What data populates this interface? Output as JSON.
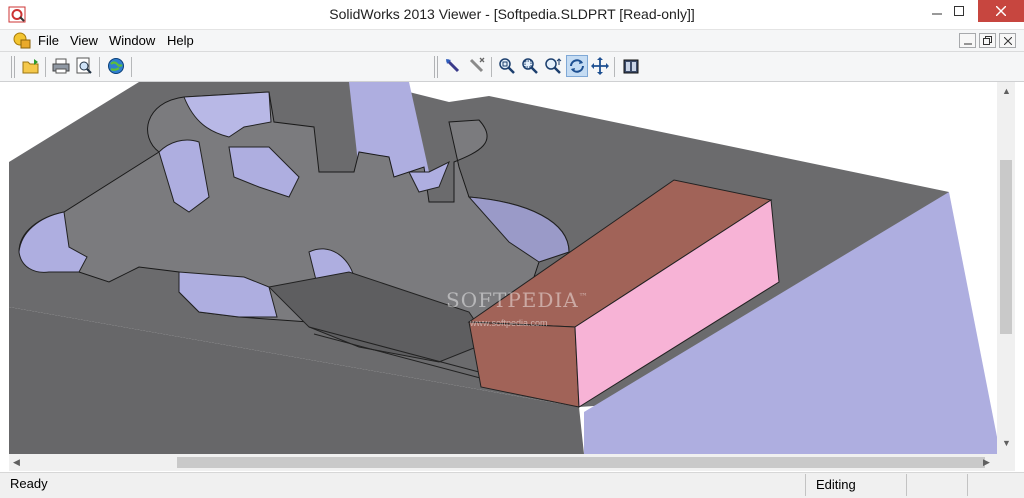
{
  "window": {
    "title": "SolidWorks 2013 Viewer - [Softpedia.SLDPRT [Read-only]]",
    "accent_close": "#c7463f"
  },
  "menu": {
    "items": [
      "File",
      "View",
      "Window",
      "Help"
    ]
  },
  "toolbar": {
    "buttons": [
      "open-icon",
      "print-icon",
      "print-preview-icon",
      "web-icon",
      "select-icon",
      "deselect-icon",
      "zoom-fit-icon",
      "zoom-area-icon",
      "zoom-in-out-icon",
      "rotate-icon",
      "pan-icon",
      "3d-view-icon"
    ],
    "active": "rotate-icon"
  },
  "viewport": {
    "watermark": "SOFTPEDIA",
    "watermark_mark": "™",
    "watermark_url": "www.softpedia.com",
    "colors": {
      "body": "#6b6b6d",
      "wall": "#aeaee0",
      "block_top": "#a16358",
      "block_face": "#f7b3d6"
    }
  },
  "status": {
    "text": "Ready",
    "mode": "Editing"
  }
}
